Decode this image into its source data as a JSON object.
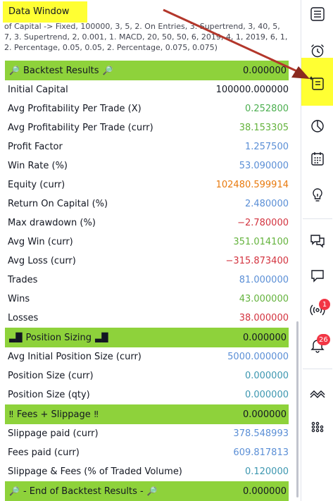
{
  "panel": {
    "title": "Data Window",
    "params_text": "of Capital -> Fixed, 100000, 3, 5, 2. On Entries, 3. Supertrend, 3, 40, 5, 7, 3. Supertrend, 2, 0.001, 1. MACD, 20, 50, 50, 6, 2019, 4, 1, 2019, 6, 1, 2. Percentage, 0.05, 0.05, 2. Percentage, 0.075, 0.075)"
  },
  "rows": [
    {
      "type": "header",
      "icon": "🔎",
      "label": "Backtest Results",
      "value": "0.000000"
    },
    {
      "type": "row",
      "label": "Initial Capital",
      "value": "100000.000000",
      "color": "neutral"
    },
    {
      "type": "row",
      "label": "Avg Profitability Per Trade (X)",
      "value": "0.252800",
      "color": "pos"
    },
    {
      "type": "row",
      "label": "Avg Profitability Per Trade (curr)",
      "value": "38.153305",
      "color": "pos2"
    },
    {
      "type": "row",
      "label": "Profit Factor",
      "value": "1.257500",
      "color": "blue"
    },
    {
      "type": "row",
      "label": "Win Rate (%)",
      "value": "53.090000",
      "color": "blue"
    },
    {
      "type": "row",
      "label": "Equity (curr)",
      "value": "102480.599914",
      "color": "orange"
    },
    {
      "type": "row",
      "label": "Return On Capital (%)",
      "value": "2.480000",
      "color": "blue"
    },
    {
      "type": "row",
      "label": "Max drawdown (%)",
      "value": "−2.780000",
      "color": "red"
    },
    {
      "type": "row",
      "label": "Avg Win (curr)",
      "value": "351.014100",
      "color": "pos2"
    },
    {
      "type": "row",
      "label": "Avg Loss (curr)",
      "value": "−315.873400",
      "color": "red"
    },
    {
      "type": "row",
      "label": "Trades",
      "value": "81.000000",
      "color": "blue"
    },
    {
      "type": "row",
      "label": "Wins",
      "value": "43.000000",
      "color": "pos2"
    },
    {
      "type": "row",
      "label": "Losses",
      "value": "38.000000",
      "color": "red"
    },
    {
      "type": "header",
      "icon": "▃█",
      "label": "Position Sizing",
      "value": "0.000000"
    },
    {
      "type": "row",
      "label": "Avg Initial Position Size (curr)",
      "value": "5000.000000",
      "color": "blue"
    },
    {
      "type": "row",
      "label": "Position Size (curr)",
      "value": "0.000000",
      "color": "teal"
    },
    {
      "type": "row",
      "label": "Position Size (qty)",
      "value": "0.000000",
      "color": "teal"
    },
    {
      "type": "header",
      "icon": "‼",
      "label": "Fees + Slippage",
      "value": "0.000000"
    },
    {
      "type": "row",
      "label": "Slippage paid (curr)",
      "value": "378.548993",
      "color": "blue"
    },
    {
      "type": "row",
      "label": "Fees paid (curr)",
      "value": "609.817813",
      "color": "blue"
    },
    {
      "type": "row",
      "label": "Slippage & Fees (% of Traded Volume)",
      "value": "0.120000",
      "color": "teal"
    },
    {
      "type": "header",
      "icon": "🔎",
      "label": "- End of Backtest Results -",
      "value": "0.000000"
    }
  ],
  "sidebar": {
    "buttons": [
      {
        "name": "watchlist-icon"
      },
      {
        "name": "alarm-clock-icon"
      },
      {
        "name": "data-window-icon"
      },
      {
        "name": "hotlist-icon"
      },
      {
        "name": "calendar-icon"
      },
      {
        "name": "ideas-bulb-icon"
      },
      {
        "name": "chats-icon"
      },
      {
        "name": "private-chat-icon"
      },
      {
        "name": "streams-icon",
        "badge": "1"
      },
      {
        "name": "notifications-bell-icon",
        "badge": "26"
      },
      {
        "name": "trading-panel-icon"
      },
      {
        "name": "more-dots-icon"
      }
    ]
  },
  "colors": {
    "header_bg": "#8ed23b",
    "highlight": "#ffff33",
    "arrow": "#b3372b"
  }
}
